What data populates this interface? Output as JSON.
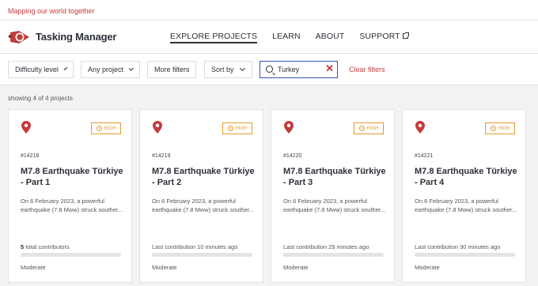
{
  "tagline": "Mapping our world together",
  "brand": "Tasking Manager",
  "nav": {
    "explore": "EXPLORE PROJECTS",
    "learn": "LEARN",
    "about": "ABOUT",
    "support": "SUPPORT"
  },
  "filters": {
    "difficulty": "Difficulty level",
    "project": "Any project",
    "more": "More filters",
    "sort": "Sort by",
    "search_value": "Turkey",
    "clear": "Clear filters"
  },
  "results_count": "showing 4 of 4 projects",
  "colors": {
    "accent": "#c43b3b",
    "priority": "#e39b2c",
    "focus": "#2d55b4"
  },
  "projects": [
    {
      "id": "#14218",
      "priority": "HIGH",
      "title": "M7.8 Earthquake Türkiye - Part 1",
      "description": "On 6 February 2023, a powerful earthquake (7.8 Mww) struck souther...",
      "contributors_count": "5",
      "contributors_text": " total contributors",
      "progress_percent": 0,
      "difficulty": "Moderate"
    },
    {
      "id": "#14219",
      "priority": "HIGH",
      "title": "M7.8 Earthquake Türkiye - Part 2",
      "description": "On 6 February 2023, a powerful earthquake (7.8 Mww) struck souther...",
      "last_contribution": "Last contribution 10 minutes ago",
      "progress_percent": 0,
      "difficulty": "Moderate"
    },
    {
      "id": "#14220",
      "priority": "HIGH",
      "title": "M7.8 Earthquake Türkiye - Part 3",
      "description": "On 6 February 2023, a powerful earthquake (7.8 Mww) struck souther...",
      "last_contribution": "Last contribution 29 minutes ago",
      "progress_percent": 0,
      "difficulty": "Moderate"
    },
    {
      "id": "#14221",
      "priority": "HIGH",
      "title": "M7.8 Earthquake Türkiye - Part 4",
      "description": "On 6 February 2023, a powerful earthquake (7.8 Mww) struck souther...",
      "last_contribution": "Last contribution 30 minutes ago",
      "progress_percent": 0,
      "difficulty": "Moderate"
    }
  ]
}
